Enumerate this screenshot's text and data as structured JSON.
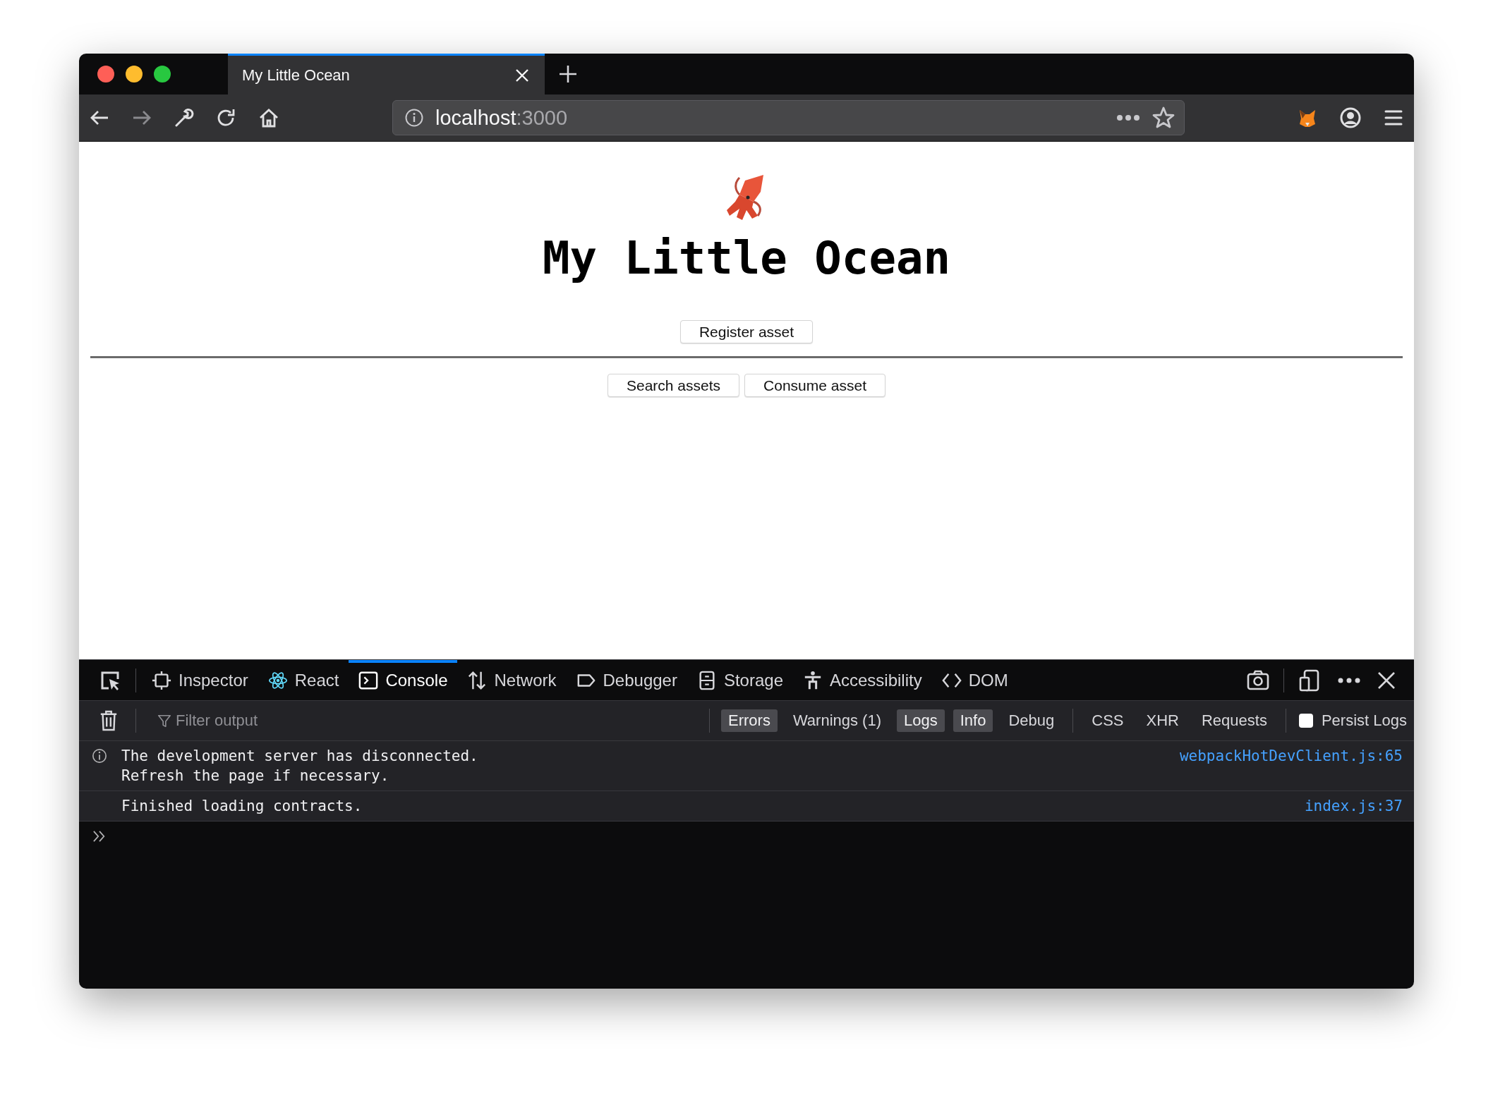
{
  "browser_tab": {
    "title": "My Little Ocean"
  },
  "url": {
    "host": "localhost",
    "port": ":3000"
  },
  "page": {
    "title": "My Little Ocean",
    "top_buttons": [
      "Register asset"
    ],
    "bottom_buttons": [
      "Search assets",
      "Consume asset"
    ]
  },
  "devtools": {
    "tabs": [
      {
        "label": "Inspector",
        "selected": false
      },
      {
        "label": "React",
        "selected": false
      },
      {
        "label": "Console",
        "selected": true
      },
      {
        "label": "Network",
        "selected": false
      },
      {
        "label": "Debugger",
        "selected": false
      },
      {
        "label": "Storage",
        "selected": false
      },
      {
        "label": "Accessibility",
        "selected": false
      },
      {
        "label": "DOM",
        "selected": false
      }
    ],
    "filter": {
      "placeholder": "Filter output"
    },
    "levels": [
      {
        "label": "Errors",
        "selected": true
      },
      {
        "label": "Warnings (1)",
        "selected": false
      },
      {
        "label": "Logs",
        "selected": true
      },
      {
        "label": "Info",
        "selected": true
      },
      {
        "label": "Debug",
        "selected": false
      }
    ],
    "request_filters": [
      {
        "label": "CSS",
        "selected": false
      },
      {
        "label": "XHR",
        "selected": false
      },
      {
        "label": "Requests",
        "selected": false
      }
    ],
    "persist_logs": {
      "label": "Persist Logs",
      "checked": false
    },
    "messages": [
      {
        "kind": "info",
        "lines": [
          "The development server has disconnected.",
          "Refresh the page if necessary."
        ],
        "source": "webpackHotDevClient.js:65"
      },
      {
        "kind": "log",
        "lines": [
          "Finished loading contracts."
        ],
        "source": "index.js:37"
      }
    ]
  }
}
